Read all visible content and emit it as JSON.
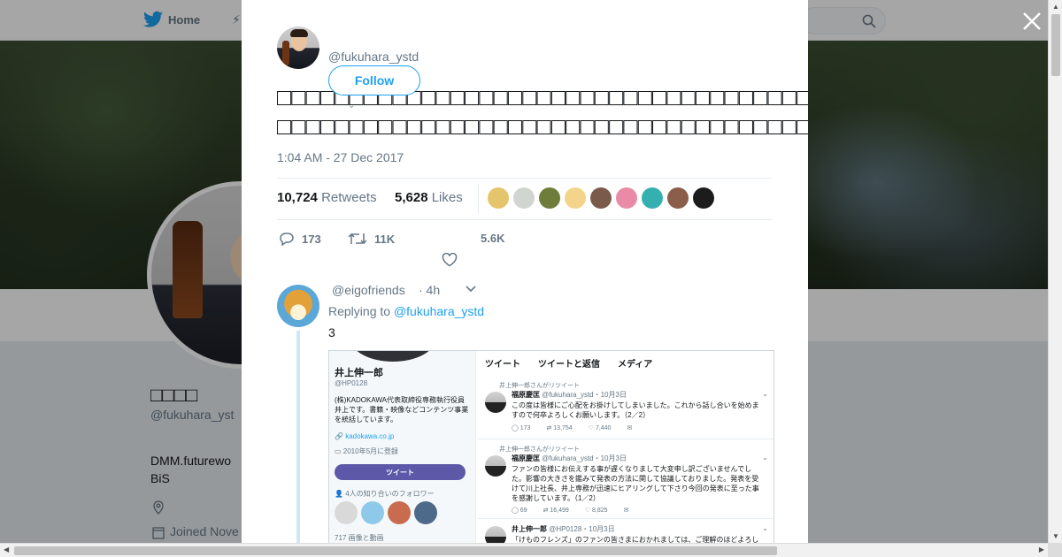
{
  "nav": {
    "home_label": "Home",
    "icons": [
      "twitter-bird-icon",
      "moments-icon",
      "search-icon"
    ]
  },
  "profile": {
    "name": "□□□□",
    "handle": "@fukuhara_yst",
    "bio_line1": "DMM.futurewo",
    "bio_line2": "BiS",
    "joined": "Joined Nove"
  },
  "tweet": {
    "handle": "@fukuhara_ystd",
    "follow_label": "Follow",
    "text": "□□□□□□□□□□□□□□□□□□□□□□□□□□□□□□□□□□□□□□□□□□□□□□□□□□□□□□□□□□□□□□□□□□□□□□□□□□□□□□□□□□□□□□□□□□",
    "time": "1:04 AM - 27 Dec 2017",
    "retweets_count": "10,724",
    "retweets_label": "Retweets",
    "likes_count": "5,628",
    "likes_label": "Likes",
    "likers_colors": [
      "#e5c56b",
      "#d0d6cf",
      "#6e7d3a",
      "#f4d38a",
      "#7a5a4a",
      "#e98ba6",
      "#34b0b0",
      "#8a5e4b",
      "#1c1c1c"
    ],
    "replies": "173",
    "retweets_short": "11K",
    "likes_short": "5.6K"
  },
  "reply": {
    "handle": "@eigofriends",
    "time": "· 4h",
    "replying_prefix": "Replying to",
    "replying_to": "@fukuhara_ystd",
    "text": "3"
  },
  "embedded": {
    "name": "井上伸一郎",
    "handle": "@HP0128",
    "bio": "(株)KADOKAWA代表取締役専務執行役員　井上です。書籍・映像などコンテンツ事業を統括しています。",
    "link": "kadokawa.co.jp",
    "joined": "2010年5月に登録",
    "tweet_button": "ツイート",
    "followers": "4人の知り合いのフォロワー",
    "media": "717 画像と動画",
    "tabs": [
      "ツイート",
      "ツイートと返信",
      "メディア"
    ],
    "tweets": [
      {
        "rt_by": "井上伸一郎さんがリツイート",
        "author": "福原慶匡",
        "meta": "@fukuhara_ystd・10月3日",
        "body": "この度は皆様にご心配をお掛けしてしまいました。これから話し合いを始めますので何卒よろしくお願いします。（2／2）",
        "stats": [
          "173",
          "13,754",
          "7,440"
        ]
      },
      {
        "rt_by": "井上伸一郎さんがリツイート",
        "author": "福原慶匡",
        "meta": "@fukuhara_ystd・10月3日",
        "body": "ファンの皆様にお伝えする事が遅くなりまして大変申し訳ございませんでした。影響の大きさを鑑みて発表の方法に関して協議しておりました。発表を受けて川上社長、井上専務が迅速にヒアリングして下さり今回の発表に至った事を感謝しています。（1／2）",
        "stats": [
          "69",
          "16,499",
          "8,825"
        ]
      },
      {
        "author": "井上伸一郎",
        "meta": "@HP0128・10月3日",
        "body": "「けものフレンズ」のファンの皆さまにおかれましては、ご理解のほどよろしく"
      }
    ]
  }
}
